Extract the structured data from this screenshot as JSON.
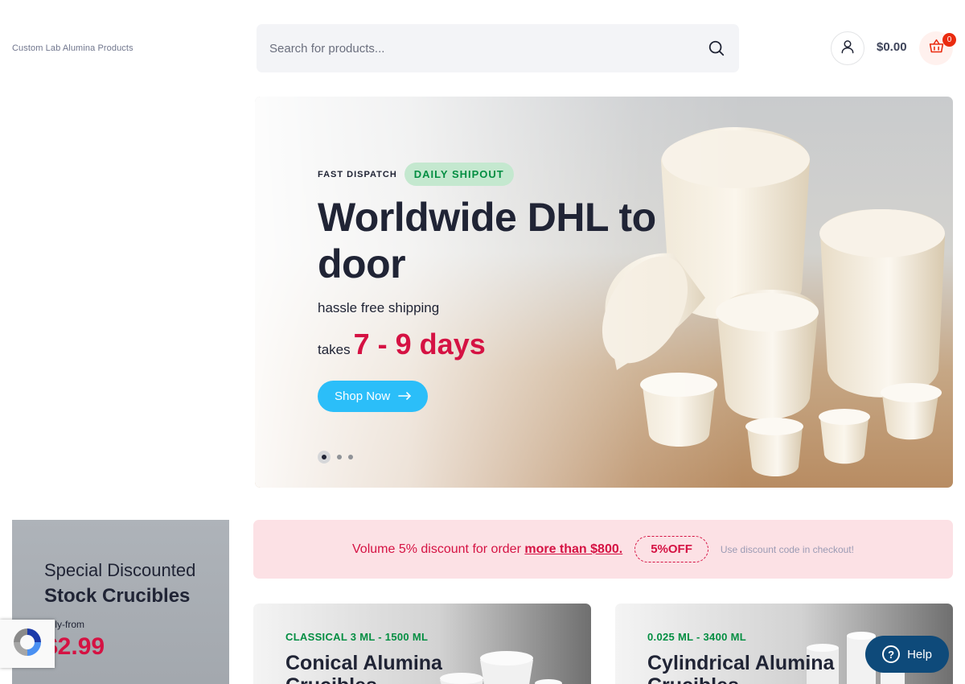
{
  "header": {
    "brand": "Custom Lab Alumina Products",
    "search_placeholder": "Search for products...",
    "cart_total": "$0.00",
    "cart_count": "0"
  },
  "hero": {
    "eyebrow": "FAST DISPATCH",
    "badge": "DAILY SHIPOUT",
    "title": "Worldwide DHL to door",
    "subtitle": "hassle free shipping",
    "takes_label": "takes",
    "takes_value": "7 - 9 days",
    "cta": "Shop Now",
    "slides": 3,
    "active_slide": 1
  },
  "promo": {
    "line1": "Special Discounted",
    "line2": "Stock Crucibles",
    "line3": "only-from",
    "price": "$2.99"
  },
  "discount": {
    "text_prefix": "Volume 5% discount for order",
    "text_strong": "more than $800.",
    "code": "5%OFF",
    "hint": "Use discount code in checkout!"
  },
  "cards": [
    {
      "eyebrow": "CLASSICAL 3 ML - 1500 ML",
      "title": "Conical Alumina Crucibles"
    },
    {
      "eyebrow": "0.025 ML - 3400 ML",
      "title": "Cylindrical Alumina Crucibles"
    }
  ],
  "help": {
    "label": "Help"
  },
  "colors": {
    "accent": "#2bbef9",
    "price_red": "#d51243",
    "green": "#038e42",
    "help_bg": "#0e4a7a"
  },
  "icons": {
    "search": "search-icon",
    "account": "user-icon",
    "cart": "basket-icon",
    "arrow": "arrow-right-icon",
    "help": "question-icon",
    "recaptcha": "recaptcha-icon"
  }
}
